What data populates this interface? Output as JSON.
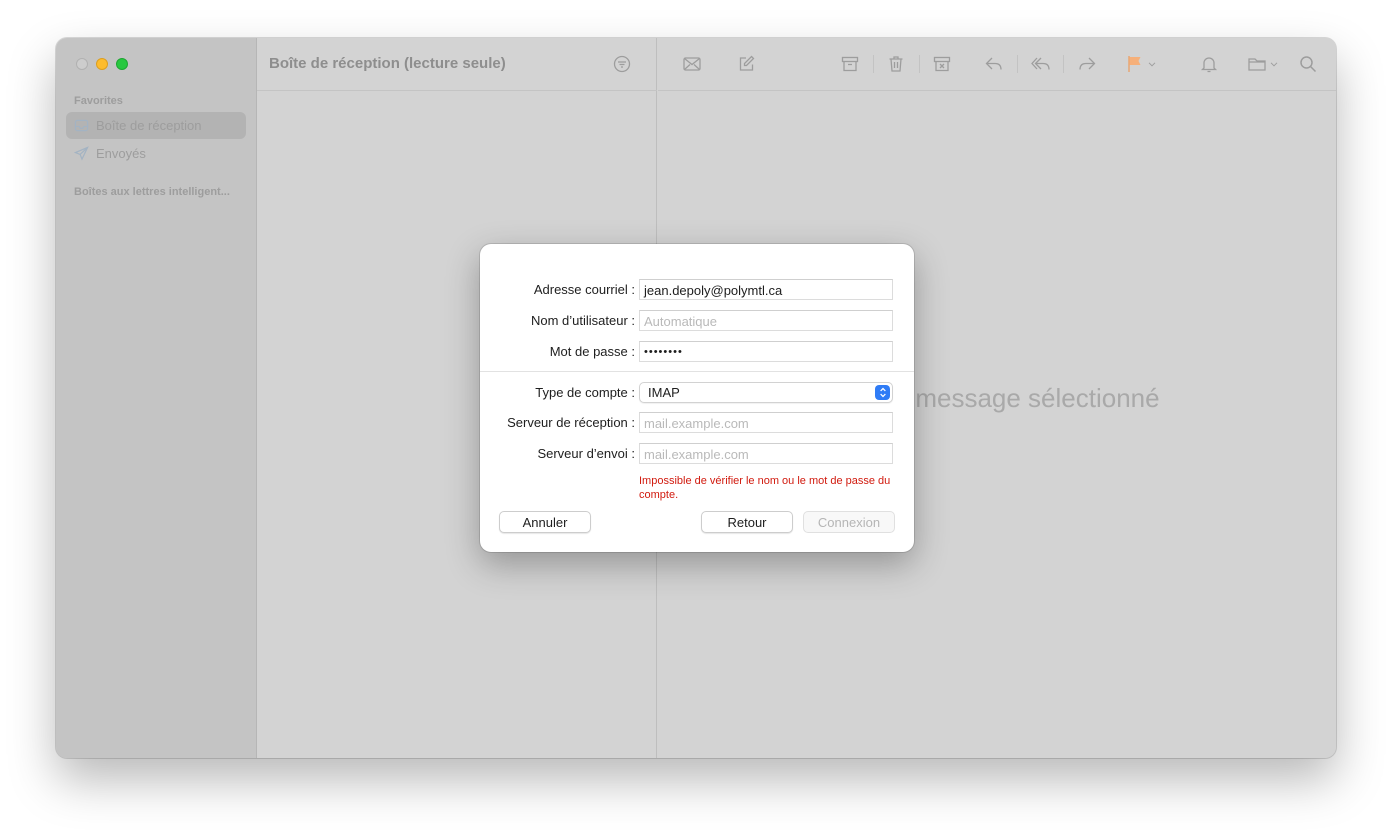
{
  "sidebar": {
    "favorites_label": "Favorites",
    "items": [
      {
        "label": "Boîte de réception",
        "icon": "inbox-icon",
        "selected": true
      },
      {
        "label": "Envoyés",
        "icon": "paper-plane-icon",
        "selected": false
      }
    ],
    "smart_mailboxes_label": "Boîtes aux lettres intelligent..."
  },
  "list": {
    "title": "Boîte de réception (lecture seule)",
    "filter_icon": "filter-icon"
  },
  "toolbar": {
    "icons": [
      "envelope-icon",
      "compose-icon",
      "archive-icon",
      "trash-icon",
      "junk-icon",
      "reply-icon",
      "reply-all-icon",
      "forward-icon",
      "flag-icon",
      "notification-bell-icon",
      "move-to-folder-icon",
      "search-icon"
    ],
    "flag_color": "#f6b07a"
  },
  "viewer": {
    "no_message_text": "Aucun message sélectionné"
  },
  "dialog": {
    "email_label": "Adresse courriel :",
    "email_value": "jean.depoly@polymtl.ca",
    "username_label": "Nom d’utilisateur :",
    "username_placeholder": "Automatique",
    "password_label": "Mot de passe :",
    "password_value": "••••••••",
    "account_type_label": "Type de compte :",
    "account_type_value": "IMAP",
    "incoming_label": "Serveur de réception :",
    "incoming_placeholder": "mail.example.com",
    "outgoing_label": "Serveur d’envoi :",
    "outgoing_placeholder": "mail.example.com",
    "error_text": "Impossible de vérifier le nom ou le mot de passe du compte.",
    "cancel_label": "Annuler",
    "back_label": "Retour",
    "connect_label": "Connexion",
    "accent_color": "#2f7cf6",
    "error_color": "#d11a0e"
  }
}
